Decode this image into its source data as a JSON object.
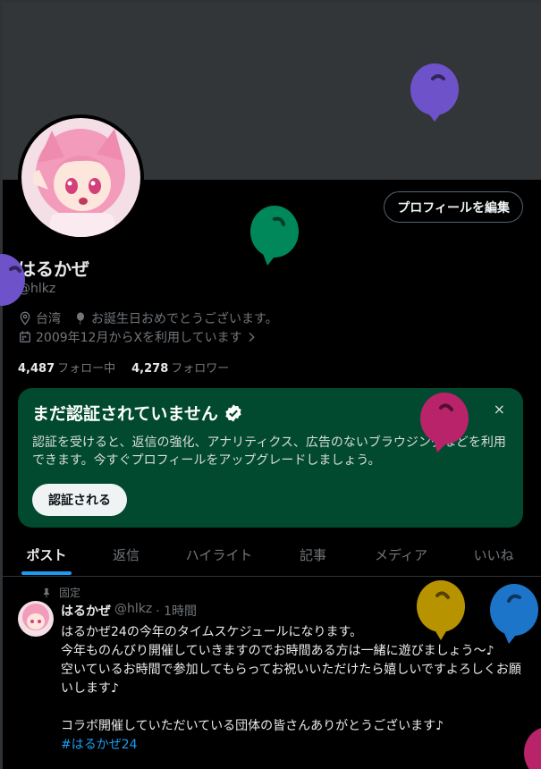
{
  "profile": {
    "edit_label": "プロフィールを編集",
    "display_name": "はるかぜ",
    "handle": "@hlkz",
    "location": "台湾",
    "birthday": "お誕生日おめでとうございます。",
    "joined": "2009年12月からXを利用しています",
    "following_count": "4,487",
    "following_label": "フォロー中",
    "followers_count": "4,278",
    "followers_label": "フォロワー"
  },
  "verify": {
    "title": "まだ認証されていません",
    "text": "認証を受けると、返信の強化、アナリティクス、広告のないブラウジングなどを利用できます。今すぐプロフィールをアップグレードしましょう。",
    "button": "認証される",
    "close": "×"
  },
  "tabs": [
    "ポスト",
    "返信",
    "ハイライト",
    "記事",
    "メディア",
    "いいね"
  ],
  "post": {
    "pinned_label": "固定",
    "name": "はるかぜ",
    "handle": "@hlkz",
    "time": "· 1時間",
    "more": "···",
    "lines": [
      "はるかぜ24の今年のタイムスケジュールになります。",
      "今年ものんびり開催していきますのでお時間ある方は一緒に遊びましょう〜♪",
      "空いているお時間で参加してもらってお祝いいただけたら嬉しいですよろしくお願いします♪",
      "",
      "コラボ開催していただいている団体の皆さんありがとうございます♪"
    ],
    "hashtag": "#はるかぜ24"
  },
  "colors": {
    "accent": "#1d9bf0",
    "verify_bg": "#014a2f",
    "balloon_purple": "#6e52c9",
    "balloon_green": "#00875a",
    "balloon_pink": "#b8236a",
    "balloon_yellow": "#b89300",
    "balloon_blue": "#1d75c9"
  }
}
